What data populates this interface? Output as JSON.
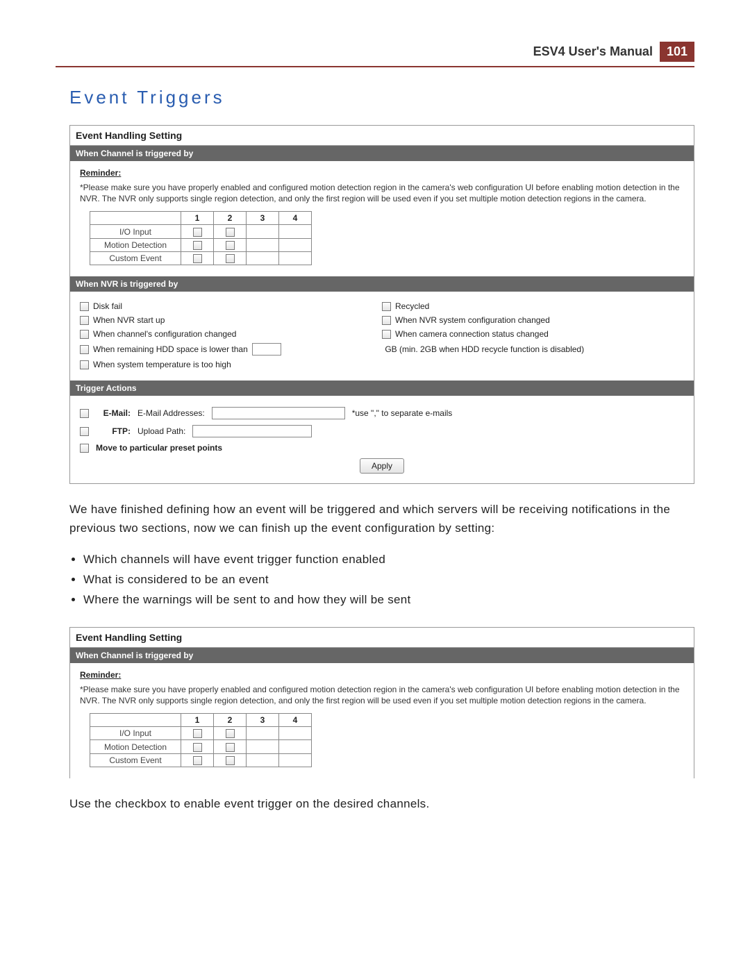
{
  "header": {
    "title": "ESV4 User's Manual",
    "page": "101"
  },
  "section_title": "Event Triggers",
  "panel": {
    "title": "Event Handling Setting",
    "bar_channel": "When Channel is triggered by",
    "reminder_label": "Reminder:",
    "reminder_text": "*Please make sure you have properly enabled and configured motion detection region in the camera's web configuration UI before enabling motion detection in the NVR. The NVR only supports single region detection, and only the first region will be used even if you set multiple motion detection regions in the camera.",
    "channel_cols": [
      "1",
      "2",
      "3",
      "4"
    ],
    "channel_rows": [
      "I/O Input",
      "Motion Detection",
      "Custom Event"
    ],
    "bar_nvr": "When NVR is triggered by",
    "nvr_rows": [
      {
        "l": "Disk fail",
        "r": "Recycled"
      },
      {
        "l": "When NVR start up",
        "r": "When NVR system configuration changed"
      },
      {
        "l": "When channel's configuration changed",
        "r": "When camera connection status changed"
      }
    ],
    "hdd_row_l": "When remaining HDD space is lower than",
    "hdd_row_r": "GB (min. 2GB when HDD recycle function is disabled)",
    "temp_row": "When system temperature is too high",
    "bar_actions": "Trigger Actions",
    "email_label": "E-Mail:",
    "email_field_label": "E-Mail Addresses:",
    "email_note": "*use \",\" to separate e-mails",
    "ftp_label": "FTP:",
    "ftp_field_label": "Upload Path:",
    "preset_label": "Move to particular preset points",
    "apply_label": "Apply"
  },
  "para1": "We have finished defining how an event will be triggered and which servers will be receiving notifications in the previous two sections, now we can finish up the event configuration by setting:",
  "bullets": [
    "Which channels will have event trigger function enabled",
    "What is considered to be an event",
    "Where the warnings will be sent to and how they will be sent"
  ],
  "para2": "Use the checkbox to enable event trigger on the desired channels."
}
